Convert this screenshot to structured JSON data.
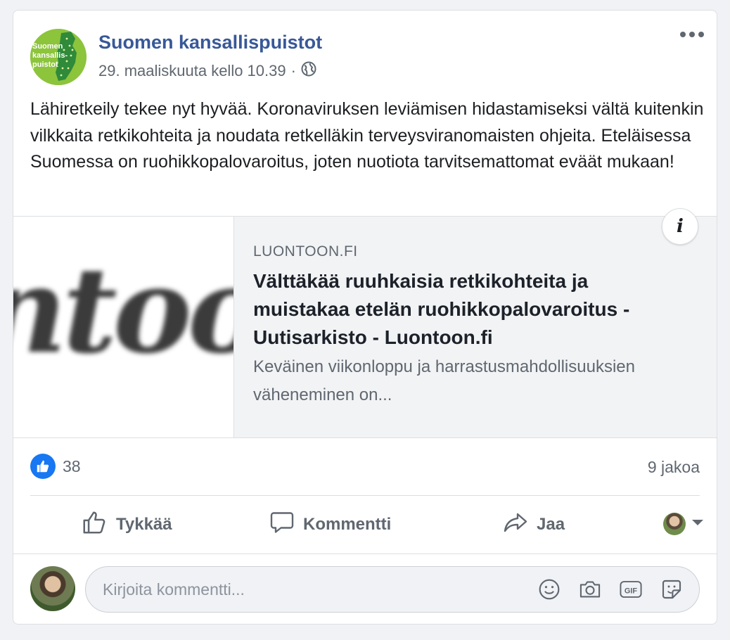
{
  "page": {
    "name": "Suomen kansallispuistot",
    "avatar_text": [
      "Suomen",
      "kansallis-",
      "puistot"
    ],
    "timestamp": "29. maaliskuuta kello 10.39",
    "separator": "·",
    "audience_icon": "globe-icon"
  },
  "post": {
    "text": "Lähiretkeily tekee nyt hyvää. Koronaviruksen leviämisen hidastamiseksi vältä kuitenkin vilkkaita retkikohteita ja noudata retkelläkin terveysviranomaisten ohjeita. Eteläisessa Suomessa on ruohikkopalovaroitus, joten nuotiota tarvitsemattomat eväät mukaan!"
  },
  "link_preview": {
    "thumbnail_text": "ntoon",
    "domain": "LUONTOON.FI",
    "title": "Välttäkää ruuhkaisia retkikohteita ja muistakaa etelän ruohikkopalovaroitus - Uutisarkisto - Luontoon.fi",
    "description": "Keväinen viikonloppu ja harrastusmahdollisuuksien väheneminen on...",
    "info_icon": "i"
  },
  "reactions": {
    "like_count": "38",
    "shares": "9 jakoa"
  },
  "actions": {
    "like": "Tykkää",
    "comment": "Kommentti",
    "share": "Jaa"
  },
  "comment": {
    "placeholder": "Kirjoita kommentti...",
    "icons": [
      "emoji-icon",
      "camera-icon",
      "gif-icon",
      "sticker-icon"
    ]
  },
  "colors": {
    "brand_blue": "#385898",
    "like_blue": "#1877f2",
    "page_avatar_green": "#8cc43c"
  }
}
